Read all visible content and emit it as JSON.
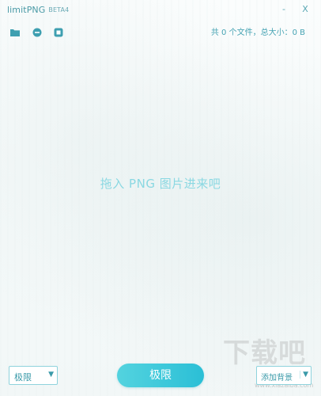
{
  "window": {
    "title": "limitPNG",
    "beta": "BETA4",
    "minimize": "-",
    "close": "X"
  },
  "toolbar": {
    "icons": [
      "folder-icon",
      "minus-circle-icon",
      "square-stop-icon"
    ],
    "status": "共 0 个文件，总大小：0 B"
  },
  "drop_zone": {
    "hint": "拖入 PNG 图片进来吧"
  },
  "bottom": {
    "mode_value": "极限",
    "primary_label": "极限",
    "add_background_label": "添加背景"
  },
  "watermark": {
    "text": "下载吧",
    "url": "www.xiazaiba.com"
  },
  "colors": {
    "accent": "#2bbfd6",
    "accent_light": "#53d3df",
    "text_accent": "#46a3b3",
    "hint": "#8ad8e2"
  }
}
